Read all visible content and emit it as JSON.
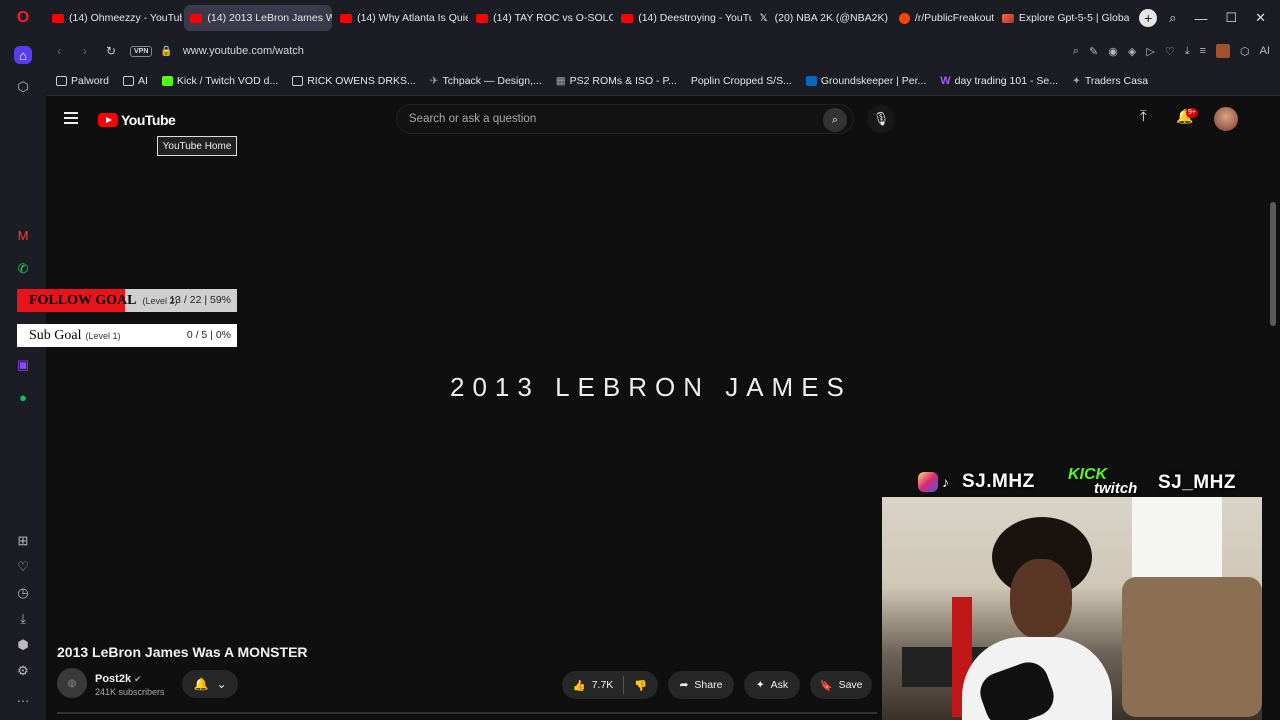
{
  "browser": {
    "tabs": [
      {
        "label": "(14) Ohmeezzy - YouTub",
        "icon": "youtube-icon"
      },
      {
        "label": "(14) 2013 LeBron James W",
        "icon": "youtube-icon",
        "active": true
      },
      {
        "label": "(14) Why Atlanta Is Quie",
        "icon": "youtube-icon"
      },
      {
        "label": "(14) TAY ROC vs O-SOLO",
        "icon": "youtube-icon"
      },
      {
        "label": "(14) Deestroying - YouTu",
        "icon": "youtube-icon"
      },
      {
        "label": "(20) NBA 2K (@NBA2K) /",
        "icon": "x-icon"
      },
      {
        "label": "/r/PublicFreakout",
        "icon": "reddit-icon"
      },
      {
        "label": "Explore Gpt-5-5 | Global",
        "icon": "explore-icon"
      }
    ],
    "tab_add": "+",
    "url": "www.youtube.com/watch",
    "vpn_label": "VPN",
    "ai_label": "AI",
    "bookmarks": [
      {
        "label": "Palword"
      },
      {
        "label": "AI"
      },
      {
        "label": "Kick / Twitch VOD d..."
      },
      {
        "label": "RICK OWENS DRKS..."
      },
      {
        "label": "Tchpack — Design,..."
      },
      {
        "label": "PS2 ROMs & ISO - P..."
      },
      {
        "label": "Poplin Cropped S/S..."
      },
      {
        "label": "Groundskeeper | Per..."
      },
      {
        "label": "day trading 101 - Se..."
      },
      {
        "label": "Traders Casa"
      }
    ]
  },
  "youtube": {
    "logo_text": "YouTube",
    "tooltip": "YouTube Home",
    "search_placeholder": "Search or ask a question",
    "notif_count": "9+"
  },
  "overlay": {
    "follow_goal_label": "FOLLOW GOAL",
    "follow_goal_level": "(Level 2)",
    "follow_goal_progress": "13 / 22 | 59%",
    "follow_goal_fraction": 0.59,
    "sub_goal_label": "Sub Goal",
    "sub_goal_level": "(Level 1)",
    "sub_goal_progress": "0 / 5 | 0%",
    "handle_left": "SJ.MHZ",
    "kick_label": "KICK",
    "twitch_label": "twitch",
    "handle_right": "SJ_MHZ"
  },
  "video": {
    "frame_text": "2013 LEBRON JAMES",
    "title": "2013 LeBron James Was A MONSTER",
    "channel": "Post2k",
    "subscribers": "241K subscribers",
    "likes": "7.7K",
    "share_label": "Share",
    "ask_label": "Ask",
    "save_label": "Save"
  }
}
